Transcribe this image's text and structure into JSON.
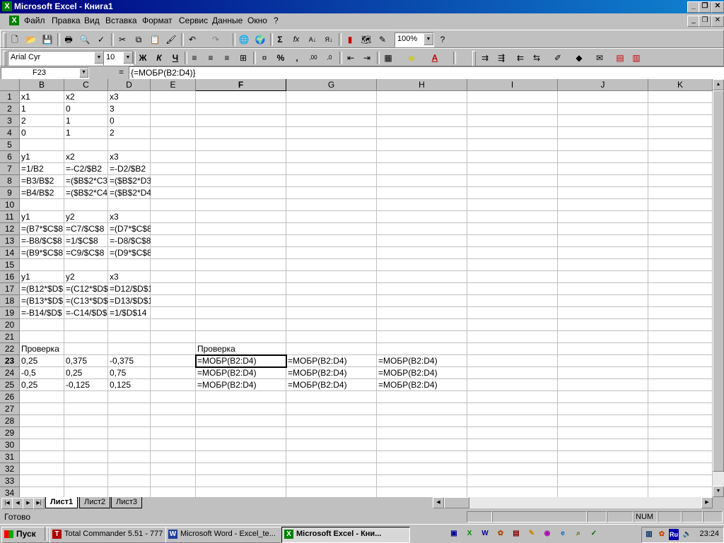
{
  "window": {
    "title": "Microsoft Excel - Книга1"
  },
  "menu": [
    "Файл",
    "Правка",
    "Вид",
    "Вставка",
    "Формат",
    "Сервис",
    "Данные",
    "Окно",
    "?"
  ],
  "toolbar": {
    "zoom": "100%",
    "font_name": "Arial Cyr",
    "font_size": "10",
    "bold": "Ж",
    "italic": "К",
    "underline": "Ч",
    "percent": "%",
    "comma": ",",
    "sum": "Σ",
    "fx": "fx"
  },
  "formula_bar": {
    "cell_ref": "F23",
    "equals": "=",
    "content": "{=МОБР(B2:D4)}"
  },
  "columns": [
    "B",
    "C",
    "D",
    "E",
    "F",
    "G",
    "H",
    "I",
    "J",
    "K"
  ],
  "rows": [
    "1",
    "2",
    "3",
    "4",
    "5",
    "6",
    "7",
    "8",
    "9",
    "10",
    "11",
    "12",
    "13",
    "14",
    "15",
    "16",
    "17",
    "18",
    "19",
    "20",
    "21",
    "22",
    "23",
    "24",
    "25",
    "26",
    "27",
    "28",
    "29",
    "30",
    "31",
    "32",
    "33",
    "34"
  ],
  "cells": {
    "r1": [
      "x1",
      "x2",
      "x3"
    ],
    "r2": [
      "1",
      "0",
      "3"
    ],
    "r3": [
      "2",
      "1",
      "0"
    ],
    "r4": [
      "0",
      "1",
      "2"
    ],
    "r6": [
      "y1",
      "x2",
      "x3"
    ],
    "r7": [
      "=1/B2",
      "=-C2/$B2",
      "=-D2/$B2"
    ],
    "r8": [
      "=B3/B$2",
      "=($B$2*C3",
      "=($B$2*D3"
    ],
    "r9": [
      "=B4/B$2",
      "=($B$2*C4",
      "=($B$2*D4"
    ],
    "r11": [
      "y1",
      "y2",
      "x3"
    ],
    "r12": [
      "=(B7*$C$8",
      "=C7/$C$8",
      "=(D7*$C$8"
    ],
    "r13": [
      "=-B8/$C$8",
      "=1/$C$8",
      "=-D8/$C$8"
    ],
    "r14": [
      "=(B9*$C$8",
      "=C9/$C$8",
      "=(D9*$C$8"
    ],
    "r16": [
      "y1",
      "y2",
      "x3"
    ],
    "r17": [
      "=(B12*$D$",
      "=(C12*$D$",
      "=D12/$D$14"
    ],
    "r18": [
      "=(B13*$D$",
      "=(C13*$D$",
      "=D13/$D$14"
    ],
    "r19": [
      "=-B14/$D$",
      "=-C14/$D$",
      "=1/$D$14"
    ],
    "r22_b": "Проверка",
    "r22_f": "Проверка",
    "r23": [
      "0,25",
      "0,375",
      "-0,375"
    ],
    "r24": [
      "-0,5",
      "0,25",
      "0,75"
    ],
    "r25": [
      "0,25",
      "-0,125",
      "0,125"
    ],
    "mobr": "=МОБР(B2:D4)"
  },
  "sheets": [
    "Лист1",
    "Лист2",
    "Лист3"
  ],
  "status": {
    "message": "Готово",
    "num": "NUM"
  },
  "taskbar": {
    "start": "Пуск",
    "items": [
      "Total Commander 5.51 - 777",
      "Microsoft Word - Excel_te...",
      "Microsoft Excel - Кни..."
    ],
    "lang": "Ru",
    "clock": "23:24"
  },
  "colors": {
    "title_start": "#000080",
    "title_end": "#1084d0",
    "face": "#c0c0c0"
  }
}
